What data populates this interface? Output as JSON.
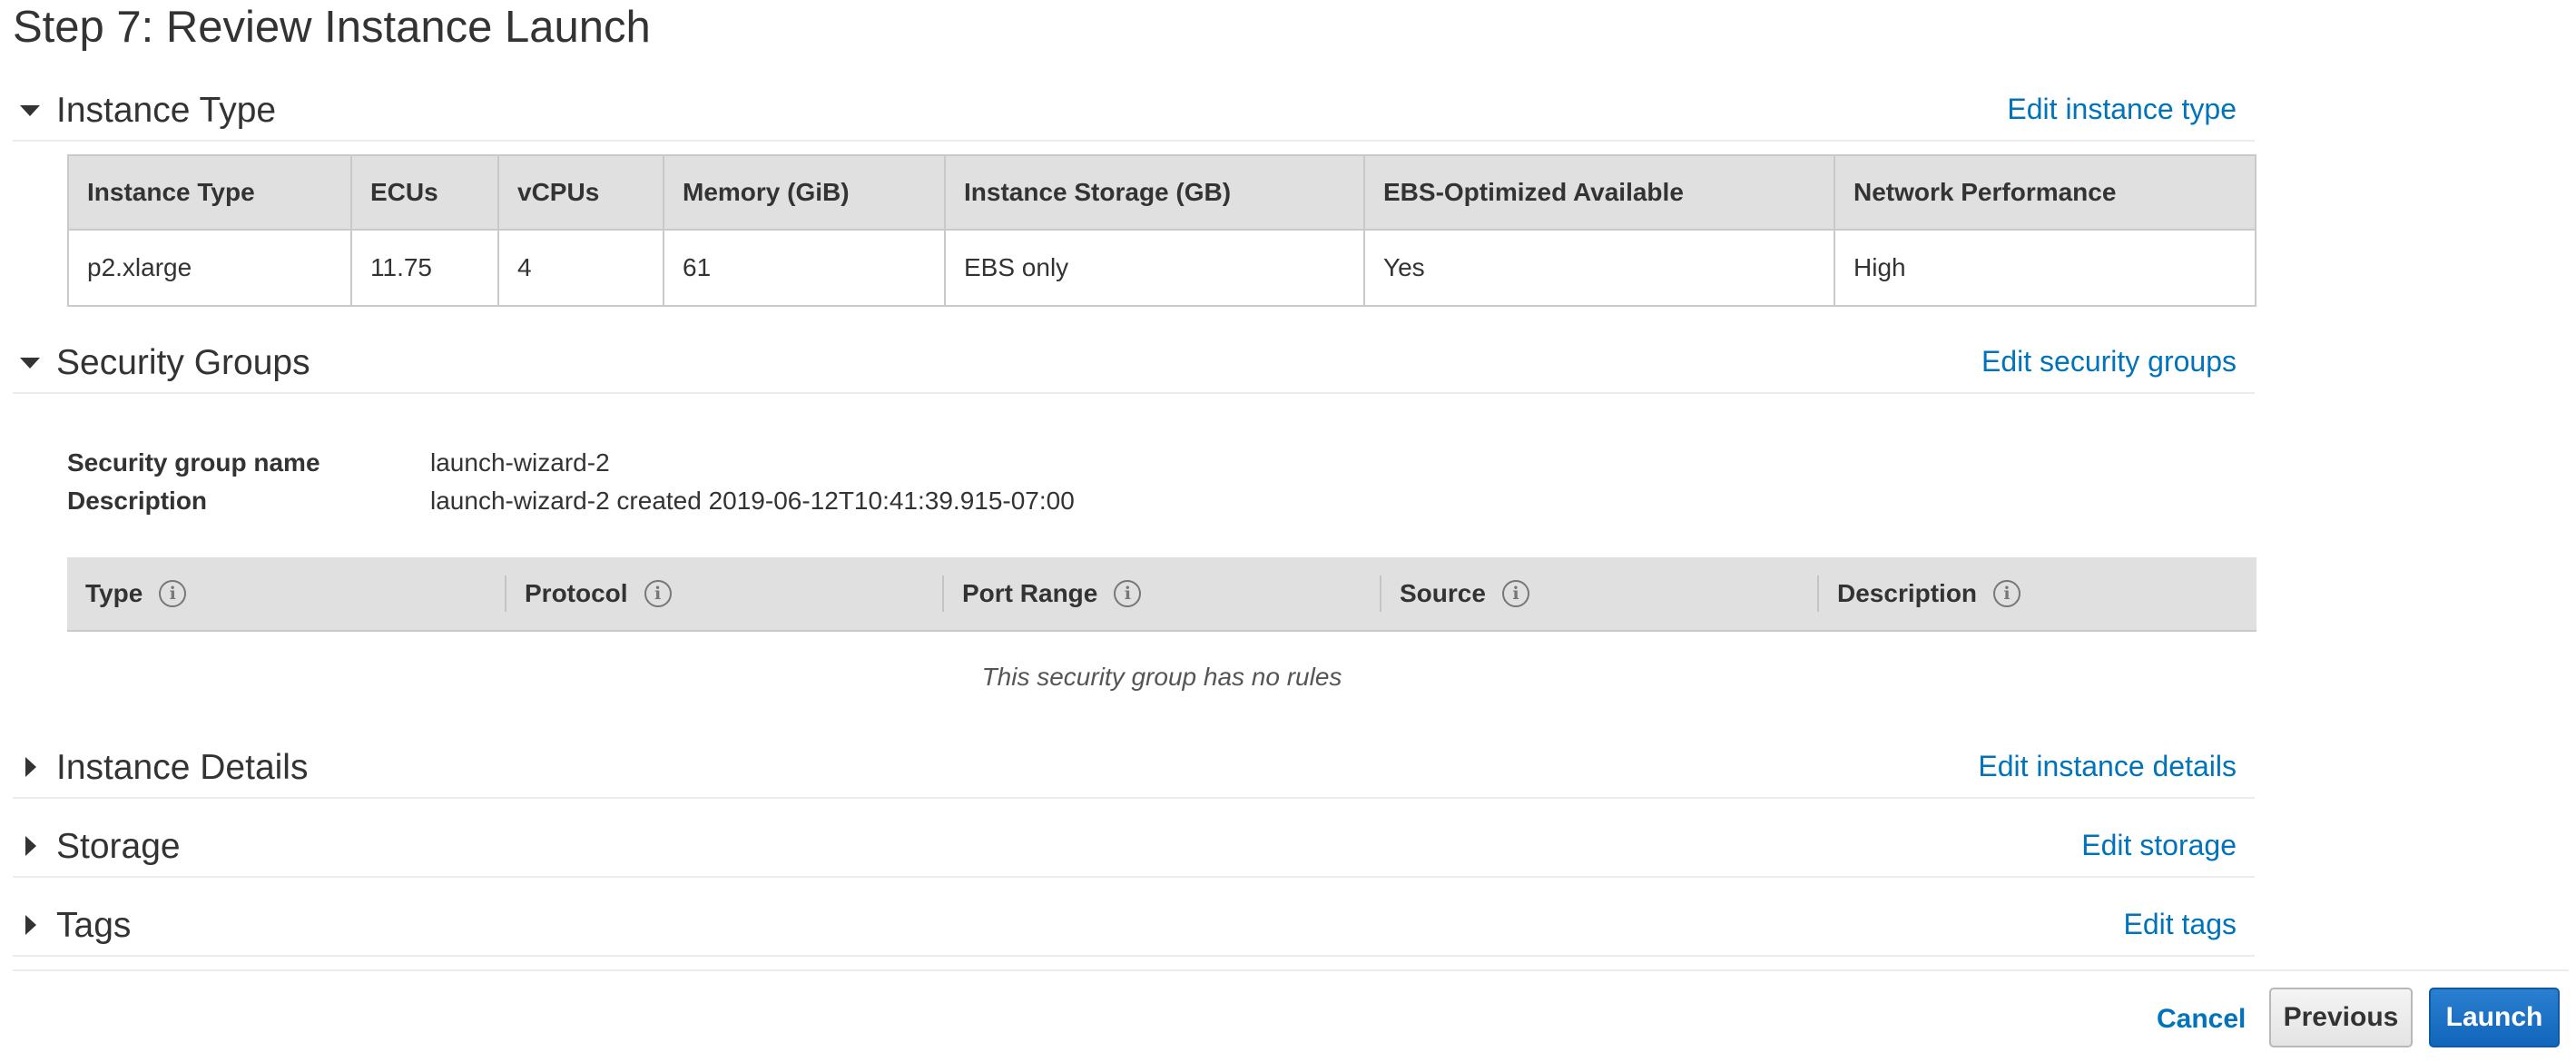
{
  "page": {
    "title": "Step 7: Review Instance Launch"
  },
  "sections": {
    "instance_type": {
      "title": "Instance Type",
      "edit": "Edit instance type",
      "expanded": true
    },
    "security_groups": {
      "title": "Security Groups",
      "edit": "Edit security groups",
      "expanded": true
    },
    "instance_details": {
      "title": "Instance Details",
      "edit": "Edit instance details",
      "expanded": false
    },
    "storage": {
      "title": "Storage",
      "edit": "Edit storage",
      "expanded": false
    },
    "tags": {
      "title": "Tags",
      "edit": "Edit tags",
      "expanded": false
    }
  },
  "instance_table": {
    "headers": [
      "Instance Type",
      "ECUs",
      "vCPUs",
      "Memory (GiB)",
      "Instance Storage (GB)",
      "EBS-Optimized Available",
      "Network Performance"
    ],
    "rows": [
      [
        "p2.xlarge",
        "11.75",
        "4",
        "61",
        "EBS only",
        "Yes",
        "High"
      ]
    ]
  },
  "security_group": {
    "name_label": "Security group name",
    "name_value": "launch-wizard-2",
    "description_label": "Description",
    "description_value": "launch-wizard-2 created 2019-06-12T10:41:39.915-07:00",
    "rules_headers": [
      "Type",
      "Protocol",
      "Port Range",
      "Source",
      "Description"
    ],
    "info_icon_glyph": "i",
    "empty_message": "This security group has no rules"
  },
  "footer": {
    "cancel": "Cancel",
    "previous": "Previous",
    "launch": "Launch"
  },
  "colors": {
    "link": "#0073bb",
    "launch_button": "#1166bb",
    "table_header": "#e0e0e0"
  }
}
